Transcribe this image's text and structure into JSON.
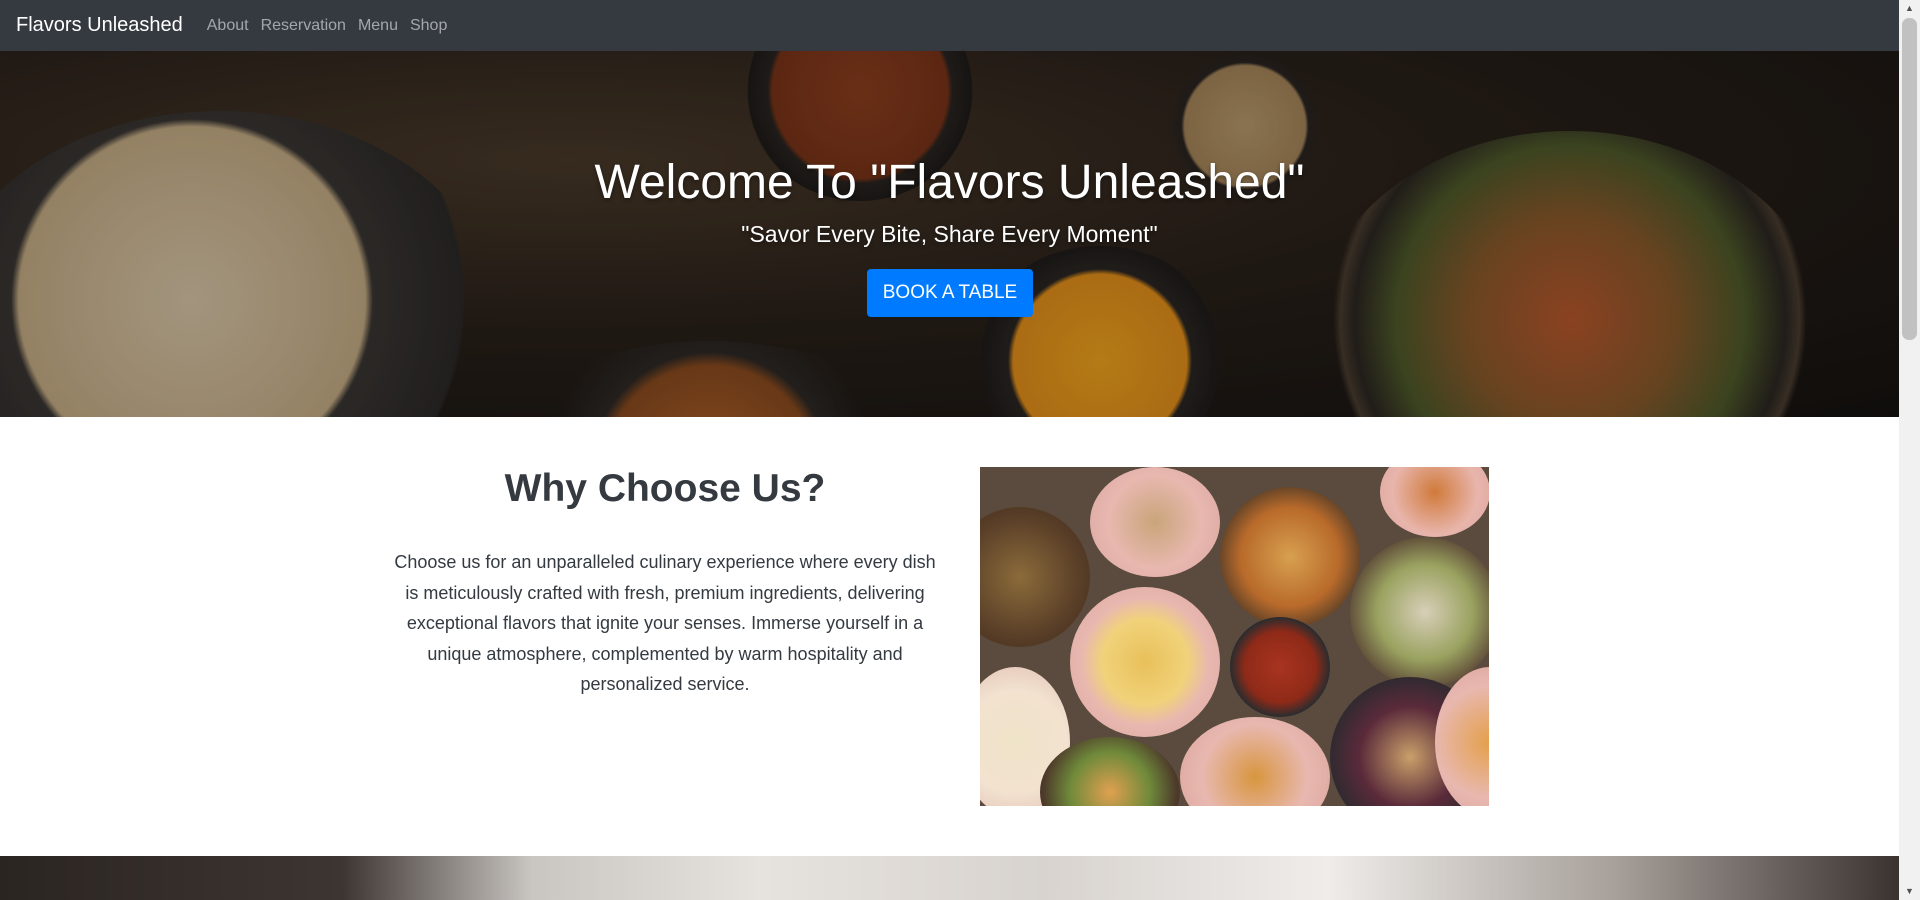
{
  "navbar": {
    "brand": "Flavors Unleashed",
    "links": [
      "About",
      "Reservation",
      "Menu",
      "Shop"
    ]
  },
  "hero": {
    "title": "Welcome To \"Flavors Unleashed\"",
    "subtitle": "\"Savor Every Bite, Share Every Moment\"",
    "cta_label": "BOOK A TABLE"
  },
  "why": {
    "title": "Why Choose Us?",
    "text": "Choose us for an unparalleled culinary experience where every dish is meticulously crafted with fresh, premium ingredients, delivering exceptional flavors that ignite your senses. Immerse yourself in a unique atmosphere, complemented by warm hospitality and personalized service."
  },
  "colors": {
    "navbar": "#343a40",
    "accent": "#007bff"
  },
  "icons": {
    "scroll_up": "chevron-up-icon",
    "scroll_down": "chevron-down-icon"
  }
}
